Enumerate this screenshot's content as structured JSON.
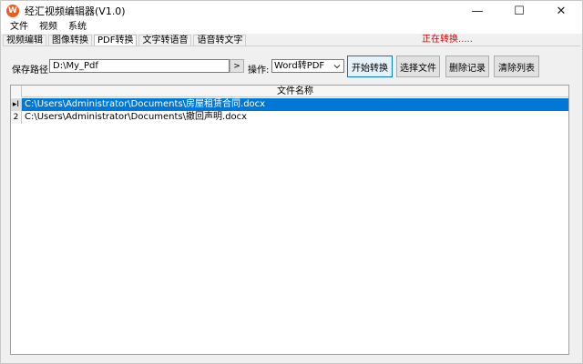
{
  "window": {
    "title": "经汇视频编辑器(V1.0)",
    "app_icon_glyph": "W",
    "minimize": "—",
    "maximize": "☐",
    "close": "✕"
  },
  "menu": [
    "文件",
    "视频",
    "系统"
  ],
  "tabs": [
    {
      "label": "视频编辑",
      "active": false
    },
    {
      "label": "图像转换",
      "active": false
    },
    {
      "label": "PDF转换",
      "active": true
    },
    {
      "label": "文字转语音",
      "active": false
    },
    {
      "label": "语音转文字",
      "active": false
    }
  ],
  "status": {
    "text": "正在转换.....",
    "color": "#e60000"
  },
  "form": {
    "save_path_label": "保存路径:",
    "save_path_value": "D:\\My_Pdf",
    "browse_label": ">",
    "operation_label": "操作:",
    "operation_value": "Word转PDF"
  },
  "buttons": {
    "start": "开始转换",
    "select_file": "选择文件",
    "delete_record": "删除记录",
    "clear_list": "清除列表"
  },
  "grid": {
    "column_header": "文件名称",
    "rows": [
      {
        "index": "▸I",
        "filename": "C:\\Users\\Administrator\\Documents\\房屋租赁合同.docx",
        "selected": true
      },
      {
        "index": "2",
        "filename": "C:\\Users\\Administrator\\Documents\\撤回声明.docx",
        "selected": false
      }
    ]
  },
  "colors": {
    "selection": "#0078d7",
    "accent_button": "#0078d7"
  }
}
